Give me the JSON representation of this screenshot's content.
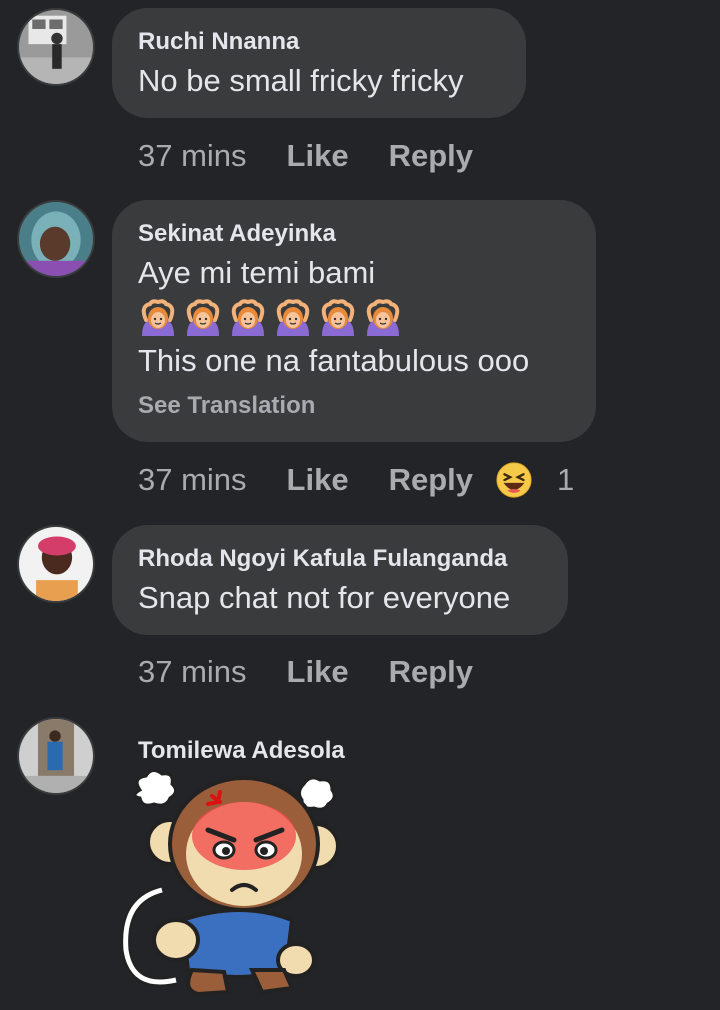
{
  "comments": [
    {
      "author": "Ruchi Nnanna",
      "text": "No be small fricky fricky",
      "time": "37 mins",
      "like_label": "Like",
      "reply_label": "Reply"
    },
    {
      "author": "Sekinat Adeyinka",
      "line1": "Aye mi temi bami",
      "emoji_name": "person-gesturing-ok-emoji",
      "emoji_count": 6,
      "line2": "This one na fantabulous ooo",
      "see_translation": "See Translation",
      "time": "37 mins",
      "like_label": "Like",
      "reply_label": "Reply",
      "reaction_icon": "laughing-face-icon",
      "reaction_count": "1"
    },
    {
      "author": "Rhoda Ngoyi Kafula Fulanganda",
      "text": "Snap chat not for everyone",
      "time": "37 mins",
      "like_label": "Like",
      "reply_label": "Reply"
    },
    {
      "author": "Tomilewa Adesola",
      "sticker": "angry-monkey-sticker"
    }
  ],
  "colors": {
    "background": "#232427",
    "bubble": "#3a3b3c",
    "primary_text": "#e4e6eb",
    "secondary_text": "#a8abaf"
  }
}
